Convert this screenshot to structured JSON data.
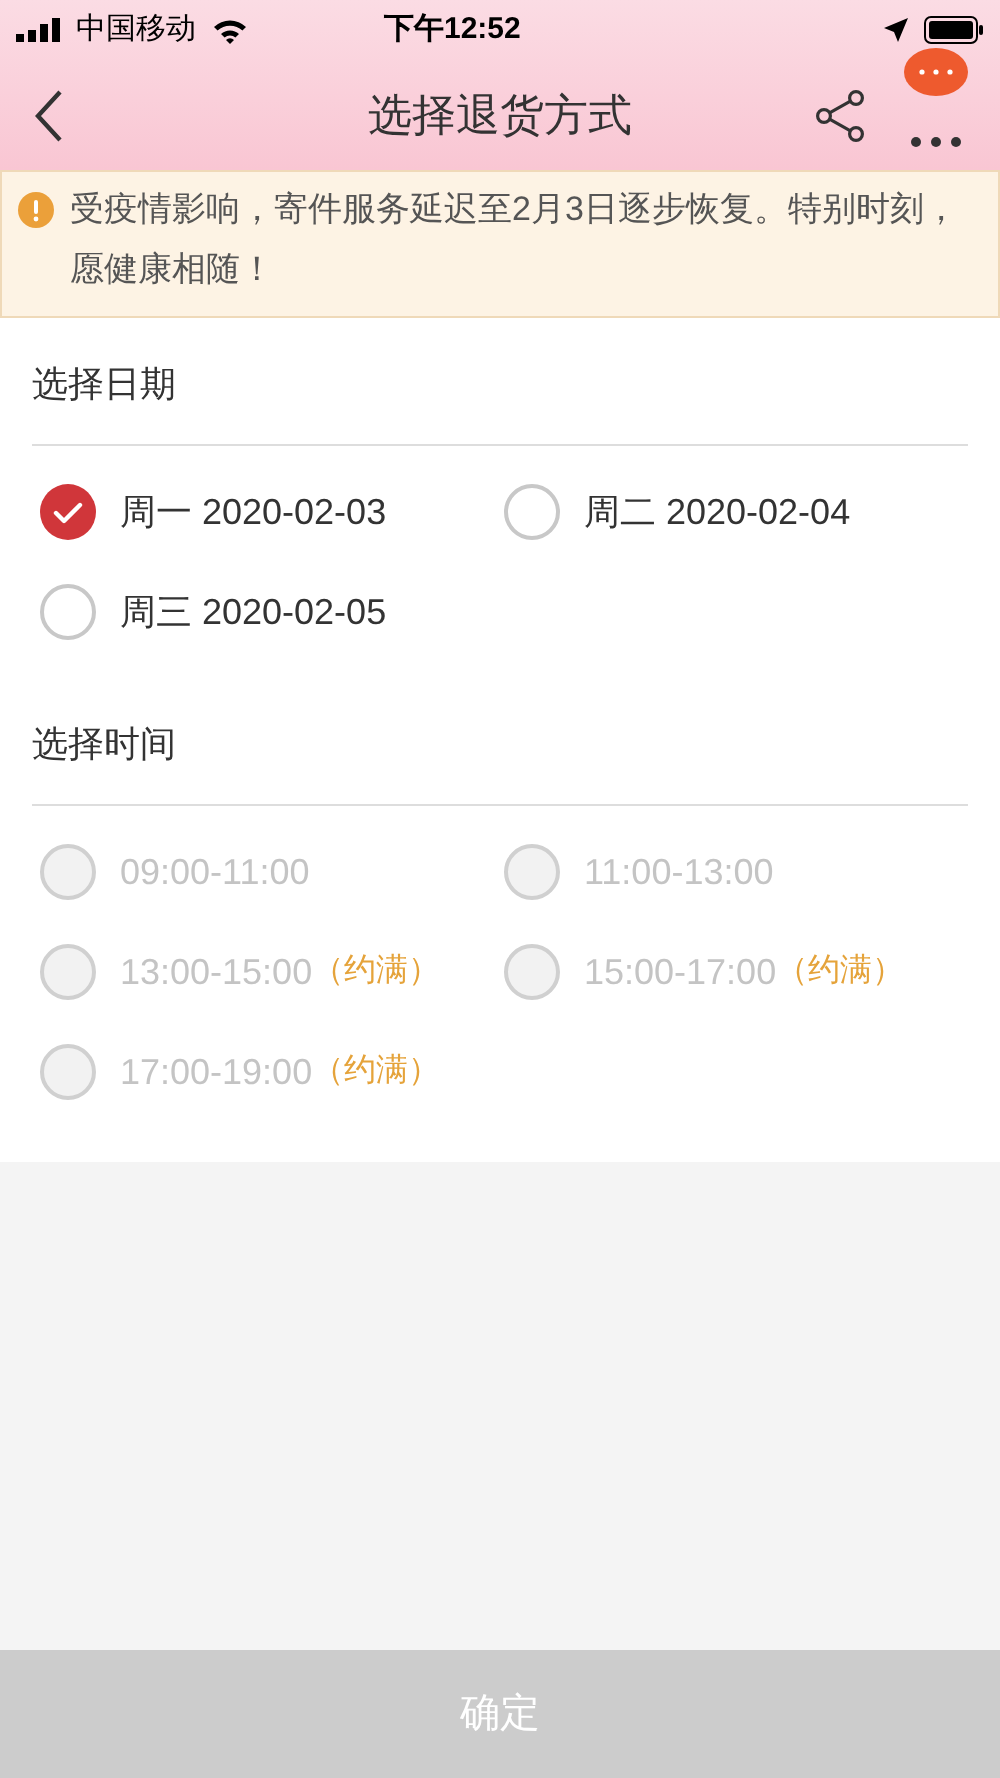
{
  "status_bar": {
    "carrier": "中国移动",
    "time": "下午12:52"
  },
  "nav": {
    "title": "选择退货方式"
  },
  "notice": {
    "text": "受疫情影响，寄件服务延迟至2月3日逐步恢复。特别时刻，愿健康相随！"
  },
  "date_section": {
    "title": "选择日期",
    "options": [
      {
        "label": "周一 2020-02-03",
        "selected": true
      },
      {
        "label": "周二 2020-02-04",
        "selected": false
      },
      {
        "label": "周三 2020-02-05",
        "selected": false
      }
    ]
  },
  "time_section": {
    "title": "选择时间",
    "options": [
      {
        "label": "09:00-11:00",
        "disabled": true,
        "selected": false
      },
      {
        "label": "11:00-13:00",
        "disabled": true,
        "selected": false
      },
      {
        "label": "13:00-15:00",
        "tag": "（约满）",
        "disabled": true,
        "selected": false
      },
      {
        "label": "15:00-17:00",
        "tag": "（约满）",
        "disabled": true,
        "selected": false
      },
      {
        "label": "17:00-19:00",
        "tag": "（约满）",
        "disabled": true,
        "selected": false
      }
    ]
  },
  "confirm_button": {
    "label": "确定",
    "disabled": true
  }
}
